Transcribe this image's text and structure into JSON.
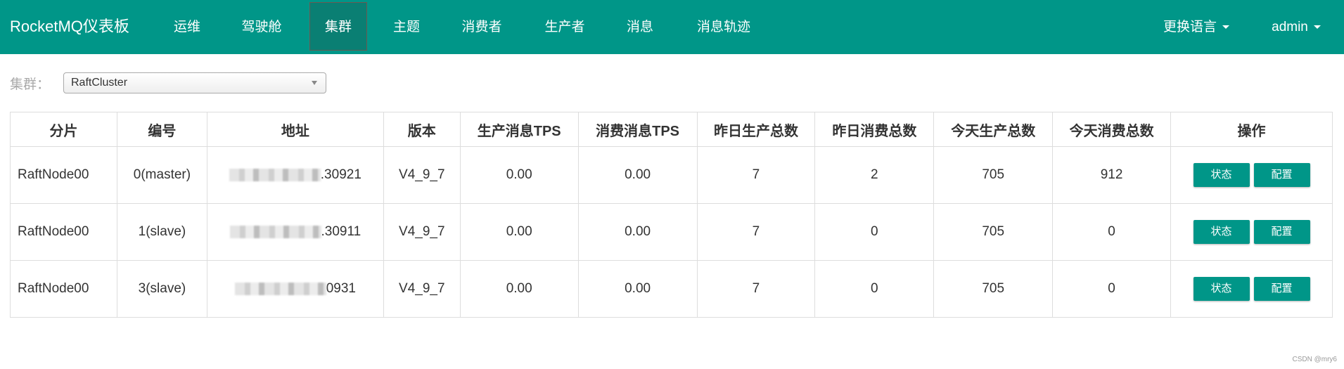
{
  "brand": "RocketMQ仪表板",
  "nav": [
    {
      "label": "运维"
    },
    {
      "label": "驾驶舱"
    },
    {
      "label": "集群",
      "active": true
    },
    {
      "label": "主题"
    },
    {
      "label": "消费者"
    },
    {
      "label": "生产者"
    },
    {
      "label": "消息"
    },
    {
      "label": "消息轨迹"
    }
  ],
  "language_menu": "更换语言",
  "user_menu": "admin",
  "filter": {
    "label": "集群：",
    "selected": "RaftCluster"
  },
  "table": {
    "headers": [
      "分片",
      "编号",
      "地址",
      "版本",
      "生产消息TPS",
      "消费消息TPS",
      "昨日生产总数",
      "昨日消费总数",
      "今天生产总数",
      "今天消费总数",
      "操作"
    ],
    "rows": [
      {
        "shard": "RaftNode00",
        "id": "0(master)",
        "addr_suffix": ".30921",
        "version": "V4_9_7",
        "prod_tps": "0.00",
        "cons_tps": "0.00",
        "yest_prod": "7",
        "yest_cons": "2",
        "today_prod": "705",
        "today_cons": "912"
      },
      {
        "shard": "RaftNode00",
        "id": "1(slave)",
        "addr_suffix": ".30911",
        "version": "V4_9_7",
        "prod_tps": "0.00",
        "cons_tps": "0.00",
        "yest_prod": "7",
        "yest_cons": "0",
        "today_prod": "705",
        "today_cons": "0"
      },
      {
        "shard": "RaftNode00",
        "id": "3(slave)",
        "addr_suffix": "0931",
        "version": "V4_9_7",
        "prod_tps": "0.00",
        "cons_tps": "0.00",
        "yest_prod": "7",
        "yest_cons": "0",
        "today_prod": "705",
        "today_cons": "0"
      }
    ],
    "actions": {
      "status": "状态",
      "config": "配置"
    }
  },
  "watermark": "CSDN @mry6",
  "colors": {
    "primary": "#009688",
    "active_nav": "#0a7f73"
  }
}
